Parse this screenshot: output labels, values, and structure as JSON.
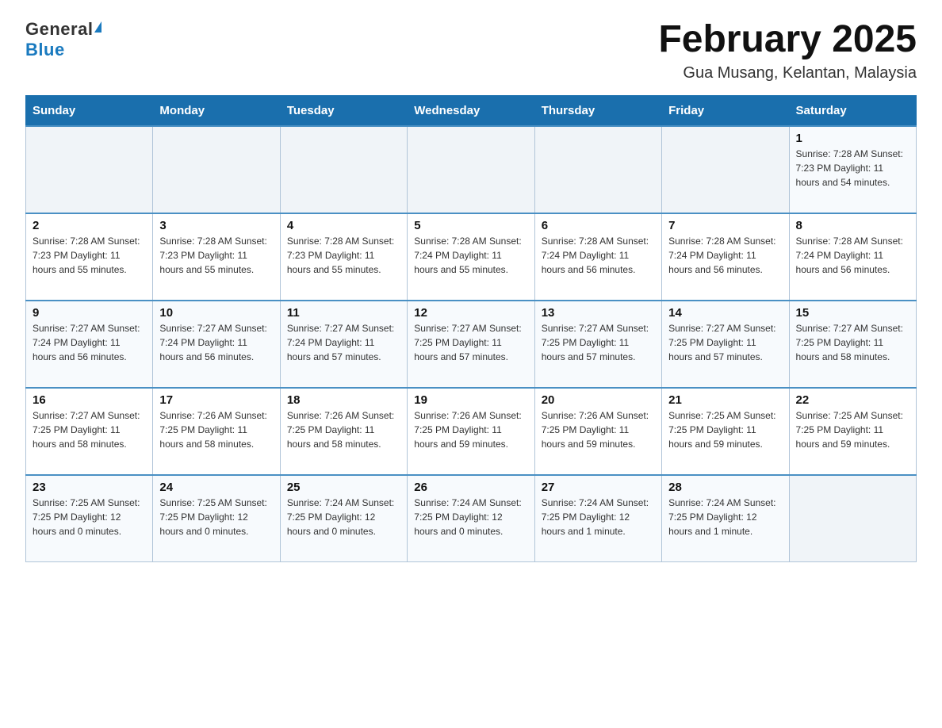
{
  "header": {
    "logo_general": "General",
    "logo_blue": "Blue",
    "month_title": "February 2025",
    "location": "Gua Musang, Kelantan, Malaysia"
  },
  "days_of_week": [
    "Sunday",
    "Monday",
    "Tuesday",
    "Wednesday",
    "Thursday",
    "Friday",
    "Saturday"
  ],
  "weeks": [
    [
      {
        "day": "",
        "info": ""
      },
      {
        "day": "",
        "info": ""
      },
      {
        "day": "",
        "info": ""
      },
      {
        "day": "",
        "info": ""
      },
      {
        "day": "",
        "info": ""
      },
      {
        "day": "",
        "info": ""
      },
      {
        "day": "1",
        "info": "Sunrise: 7:28 AM\nSunset: 7:23 PM\nDaylight: 11 hours and 54 minutes."
      }
    ],
    [
      {
        "day": "2",
        "info": "Sunrise: 7:28 AM\nSunset: 7:23 PM\nDaylight: 11 hours and 55 minutes."
      },
      {
        "day": "3",
        "info": "Sunrise: 7:28 AM\nSunset: 7:23 PM\nDaylight: 11 hours and 55 minutes."
      },
      {
        "day": "4",
        "info": "Sunrise: 7:28 AM\nSunset: 7:23 PM\nDaylight: 11 hours and 55 minutes."
      },
      {
        "day": "5",
        "info": "Sunrise: 7:28 AM\nSunset: 7:24 PM\nDaylight: 11 hours and 55 minutes."
      },
      {
        "day": "6",
        "info": "Sunrise: 7:28 AM\nSunset: 7:24 PM\nDaylight: 11 hours and 56 minutes."
      },
      {
        "day": "7",
        "info": "Sunrise: 7:28 AM\nSunset: 7:24 PM\nDaylight: 11 hours and 56 minutes."
      },
      {
        "day": "8",
        "info": "Sunrise: 7:28 AM\nSunset: 7:24 PM\nDaylight: 11 hours and 56 minutes."
      }
    ],
    [
      {
        "day": "9",
        "info": "Sunrise: 7:27 AM\nSunset: 7:24 PM\nDaylight: 11 hours and 56 minutes."
      },
      {
        "day": "10",
        "info": "Sunrise: 7:27 AM\nSunset: 7:24 PM\nDaylight: 11 hours and 56 minutes."
      },
      {
        "day": "11",
        "info": "Sunrise: 7:27 AM\nSunset: 7:24 PM\nDaylight: 11 hours and 57 minutes."
      },
      {
        "day": "12",
        "info": "Sunrise: 7:27 AM\nSunset: 7:25 PM\nDaylight: 11 hours and 57 minutes."
      },
      {
        "day": "13",
        "info": "Sunrise: 7:27 AM\nSunset: 7:25 PM\nDaylight: 11 hours and 57 minutes."
      },
      {
        "day": "14",
        "info": "Sunrise: 7:27 AM\nSunset: 7:25 PM\nDaylight: 11 hours and 57 minutes."
      },
      {
        "day": "15",
        "info": "Sunrise: 7:27 AM\nSunset: 7:25 PM\nDaylight: 11 hours and 58 minutes."
      }
    ],
    [
      {
        "day": "16",
        "info": "Sunrise: 7:27 AM\nSunset: 7:25 PM\nDaylight: 11 hours and 58 minutes."
      },
      {
        "day": "17",
        "info": "Sunrise: 7:26 AM\nSunset: 7:25 PM\nDaylight: 11 hours and 58 minutes."
      },
      {
        "day": "18",
        "info": "Sunrise: 7:26 AM\nSunset: 7:25 PM\nDaylight: 11 hours and 58 minutes."
      },
      {
        "day": "19",
        "info": "Sunrise: 7:26 AM\nSunset: 7:25 PM\nDaylight: 11 hours and 59 minutes."
      },
      {
        "day": "20",
        "info": "Sunrise: 7:26 AM\nSunset: 7:25 PM\nDaylight: 11 hours and 59 minutes."
      },
      {
        "day": "21",
        "info": "Sunrise: 7:25 AM\nSunset: 7:25 PM\nDaylight: 11 hours and 59 minutes."
      },
      {
        "day": "22",
        "info": "Sunrise: 7:25 AM\nSunset: 7:25 PM\nDaylight: 11 hours and 59 minutes."
      }
    ],
    [
      {
        "day": "23",
        "info": "Sunrise: 7:25 AM\nSunset: 7:25 PM\nDaylight: 12 hours and 0 minutes."
      },
      {
        "day": "24",
        "info": "Sunrise: 7:25 AM\nSunset: 7:25 PM\nDaylight: 12 hours and 0 minutes."
      },
      {
        "day": "25",
        "info": "Sunrise: 7:24 AM\nSunset: 7:25 PM\nDaylight: 12 hours and 0 minutes."
      },
      {
        "day": "26",
        "info": "Sunrise: 7:24 AM\nSunset: 7:25 PM\nDaylight: 12 hours and 0 minutes."
      },
      {
        "day": "27",
        "info": "Sunrise: 7:24 AM\nSunset: 7:25 PM\nDaylight: 12 hours and 1 minute."
      },
      {
        "day": "28",
        "info": "Sunrise: 7:24 AM\nSunset: 7:25 PM\nDaylight: 12 hours and 1 minute."
      },
      {
        "day": "",
        "info": ""
      }
    ]
  ]
}
